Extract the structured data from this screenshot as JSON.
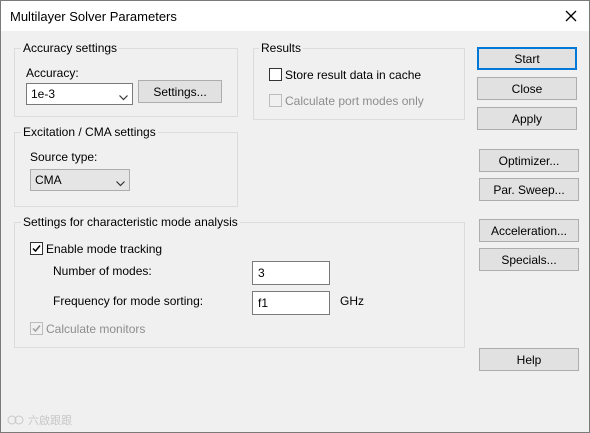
{
  "window": {
    "title": "Multilayer Solver Parameters"
  },
  "accuracy_group": {
    "title": "Accuracy settings",
    "accuracy_label": "Accuracy:",
    "accuracy_value": "1e-3",
    "settings_button": "Settings..."
  },
  "results_group": {
    "title": "Results",
    "store_label": "Store result data in cache",
    "store_checked": false,
    "port_modes_label": "Calculate port modes only",
    "port_modes_checked": false,
    "port_modes_enabled": false
  },
  "excitation_group": {
    "title": "Excitation / CMA settings",
    "source_type_label": "Source type:",
    "source_type_value": "CMA"
  },
  "cma_group": {
    "title": "Settings for characteristic mode analysis",
    "enable_tracking_label": "Enable mode tracking",
    "enable_tracking_checked": true,
    "num_modes_label": "Number of modes:",
    "num_modes_value": "3",
    "freq_label": "Frequency for mode sorting:",
    "freq_value": "f1",
    "freq_unit": "GHz",
    "monitors_label": "Calculate monitors",
    "monitors_checked": true,
    "monitors_enabled": false
  },
  "side_buttons": {
    "start": "Start",
    "close": "Close",
    "apply": "Apply",
    "optimizer": "Optimizer...",
    "par_sweep": "Par. Sweep...",
    "acceleration": "Acceleration...",
    "specials": "Specials...",
    "help": "Help"
  },
  "watermark": {
    "text": "六啟跟跟"
  }
}
